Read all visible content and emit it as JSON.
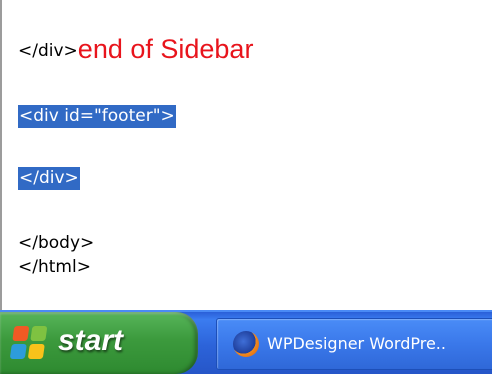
{
  "editor": {
    "lines": [
      {
        "text": "</div>",
        "note": "end of Sidebar"
      },
      {
        "text": "<div id=\"footer\">",
        "selected": true
      },
      {
        "text": "</div>",
        "selected": true
      },
      {
        "text": "</body>"
      },
      {
        "text": "</html>"
      }
    ]
  },
  "taskbar": {
    "start_label": "start",
    "task_label": "WPDesigner WordPre..",
    "task_icon": "firefox-icon"
  },
  "colors": {
    "annotation": "#e8141c",
    "selection": "#316ac5",
    "taskbar": "#2c63d9",
    "start_button": "#3c9a3d"
  }
}
